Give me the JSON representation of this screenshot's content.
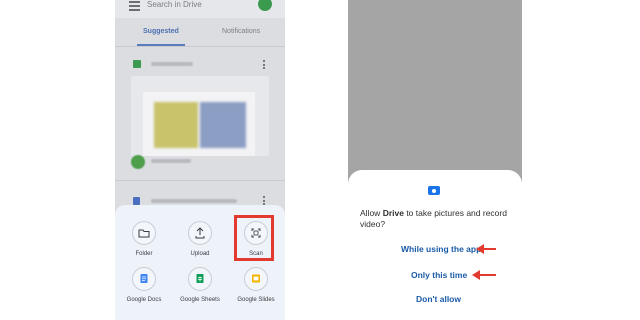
{
  "left_phone": {
    "search": {
      "placeholder": "Search in Drive"
    },
    "tabs": [
      {
        "label": "Suggested",
        "active": true
      },
      {
        "label": "Notifications",
        "active": false
      }
    ],
    "new_menu": {
      "items": [
        {
          "label": "Folder",
          "icon": "folder-icon"
        },
        {
          "label": "Upload",
          "icon": "upload-icon"
        },
        {
          "label": "Scan",
          "icon": "scan-icon",
          "highlighted": true
        },
        {
          "label": "Google Docs",
          "icon": "google-docs-icon"
        },
        {
          "label": "Google Sheets",
          "icon": "google-sheets-icon"
        },
        {
          "label": "Google Slides",
          "icon": "google-slides-icon"
        }
      ]
    }
  },
  "right_phone": {
    "dialog": {
      "prefix": "Allow ",
      "app": "Drive",
      "suffix": " to take pictures and record video?",
      "options": [
        {
          "label": "While using the app",
          "arrow": true
        },
        {
          "label": "Only this time",
          "arrow": true
        },
        {
          "label": "Don't allow",
          "arrow": false
        }
      ]
    }
  },
  "colors": {
    "highlight": "#e23a2f",
    "accent_blue": "#1a73e8",
    "sheets_green": "#3c9a4e",
    "slides_yellow": "#f4b400",
    "docs_blue": "#4285f4"
  }
}
